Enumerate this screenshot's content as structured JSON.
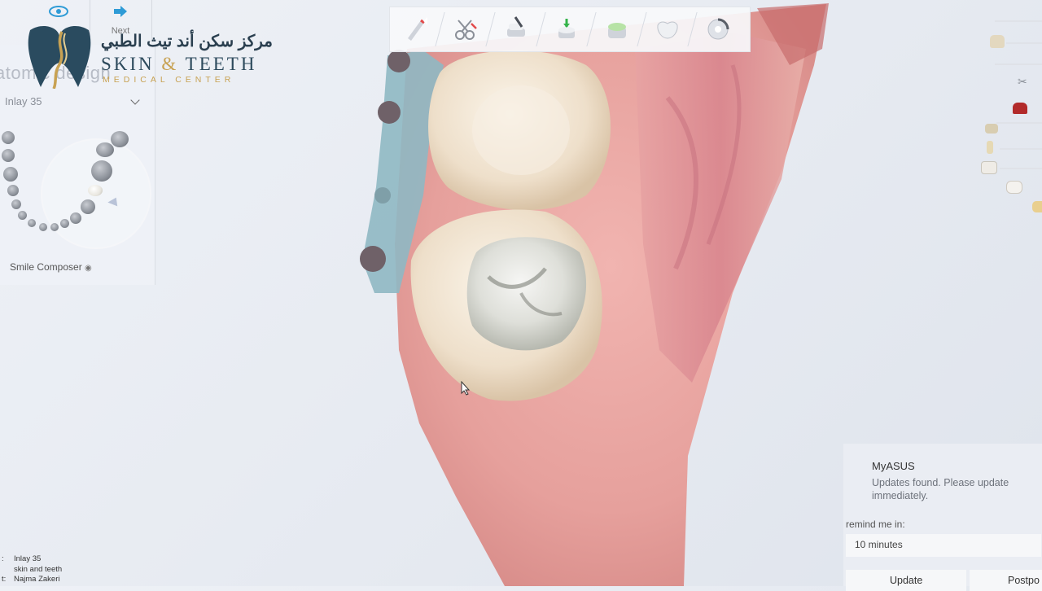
{
  "nav": {
    "prev_label": "",
    "next_label": "Next"
  },
  "left_panel": {
    "title": "atomic design",
    "tooth_select": "Inlay 35",
    "smile_composer": "Smile Composer",
    "smile_composer_icon": "eye-icon"
  },
  "logo": {
    "arabic": "مركز سكن أند تيث الطبي",
    "english_left": "SKIN ",
    "english_amp": "&",
    "english_right": " TEETH",
    "subtitle": "MEDICAL CENTER"
  },
  "toolbar": {
    "tools": [
      {
        "name": "pencil-tool-icon"
      },
      {
        "name": "cut-tool-icon"
      },
      {
        "name": "form-tool-icon"
      },
      {
        "name": "apply-tool-icon"
      },
      {
        "name": "shape-tool-icon"
      },
      {
        "name": "smooth-tool-icon"
      },
      {
        "name": "position-tool-icon"
      }
    ]
  },
  "notification": {
    "app": "MyASUS",
    "message": "Updates found. Please update immediately.",
    "remind_label": "remind me in:",
    "remind_value": "10 minutes",
    "update_button": "Update",
    "postpone_button": "Postpo"
  },
  "info": {
    "case_key": ":",
    "case": "Inlay 35",
    "clinic": "skin and teeth",
    "doctor_key": "t:",
    "doctor": "Najma Zakeri"
  },
  "colors": {
    "accent": "#2e9bd6",
    "logo_blue": "#2a4b5f",
    "logo_gold": "#c8a253",
    "gum": "#e8a3a0"
  }
}
